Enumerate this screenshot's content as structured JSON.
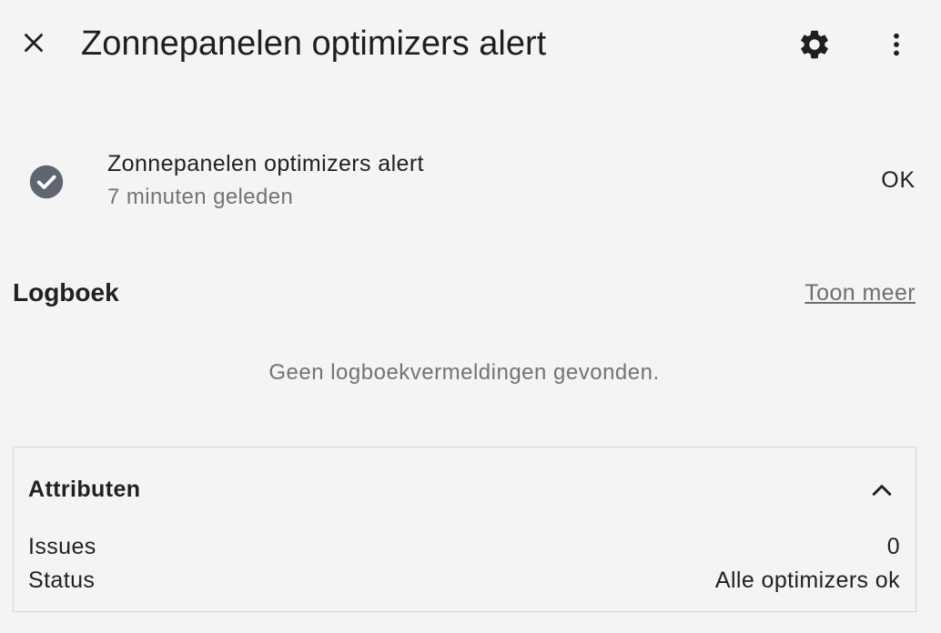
{
  "header": {
    "title": "Zonnepanelen optimizers alert",
    "icons": {
      "close": "close-icon",
      "settings": "gear-icon",
      "more": "more-vert-icon"
    }
  },
  "entity": {
    "name": "Zonnepanelen optimizers alert",
    "last_changed": "7 minuten geleden",
    "state": "OK",
    "icon": "check-circle-icon",
    "icon_color": "#5f6672"
  },
  "logbook": {
    "title": "Logboek",
    "show_more": "Toon meer",
    "empty_message": "Geen logboekvermeldingen gevonden."
  },
  "attributes": {
    "title": "Attributen",
    "expanded": true,
    "rows": [
      {
        "key": "Issues",
        "value": "0"
      },
      {
        "key": "Status",
        "value": "Alle optimizers ok"
      }
    ]
  }
}
